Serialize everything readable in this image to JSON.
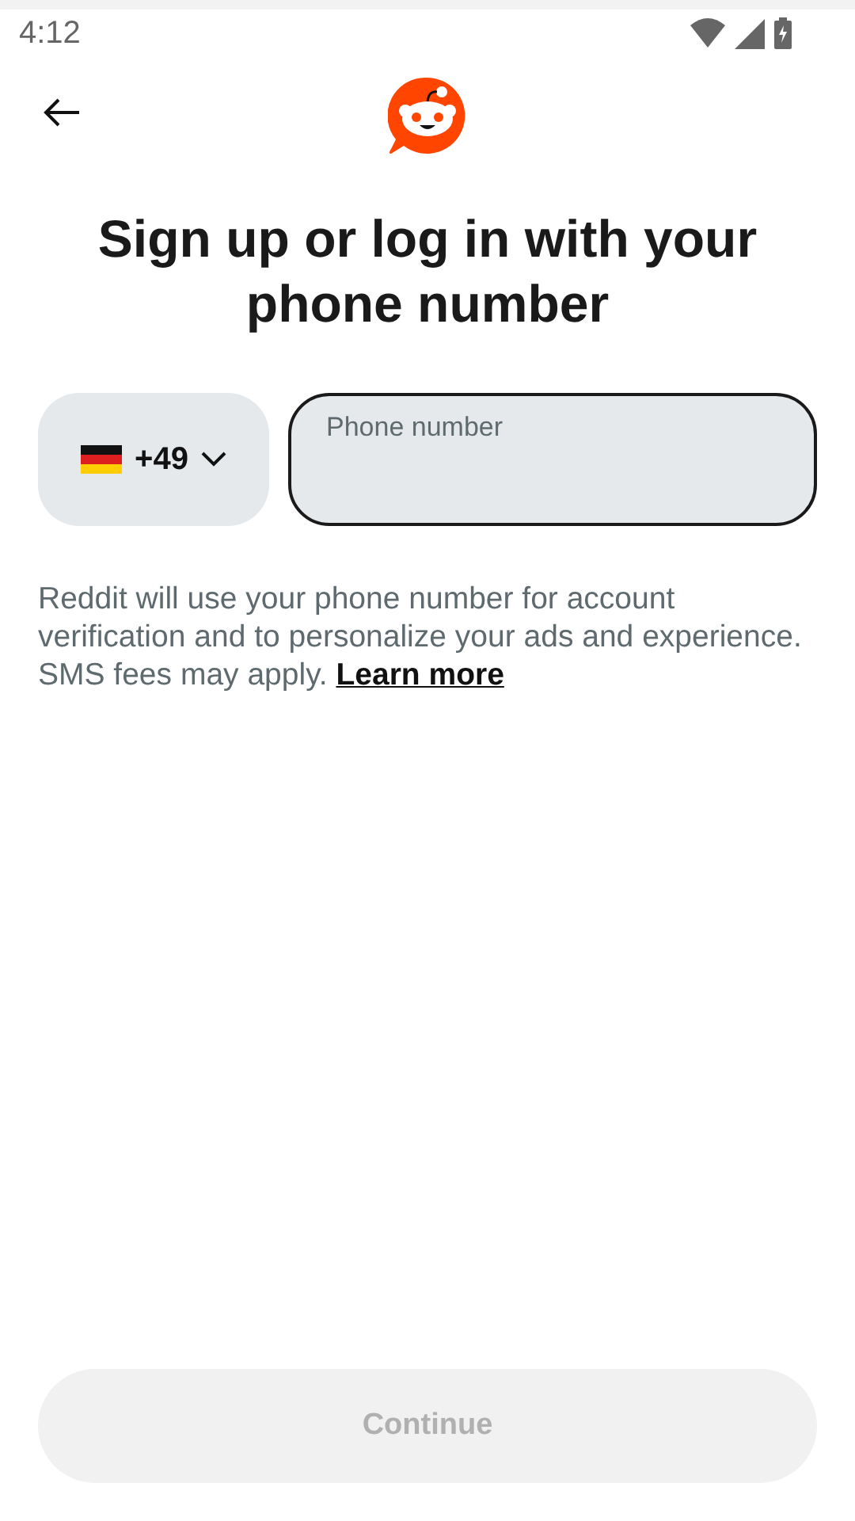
{
  "status_bar": {
    "time": "4:12"
  },
  "title": "Sign up or log in with your phone number",
  "country_selector": {
    "code": "+49"
  },
  "phone_field": {
    "placeholder": "Phone number",
    "focused": true
  },
  "disclaimer": {
    "text": "Reddit will use your phone number for account verification and to personalize your ads and experience. SMS fees may apply.",
    "link": "Learn more"
  },
  "continue_button": {
    "label": "Continue",
    "disabled": true
  }
}
